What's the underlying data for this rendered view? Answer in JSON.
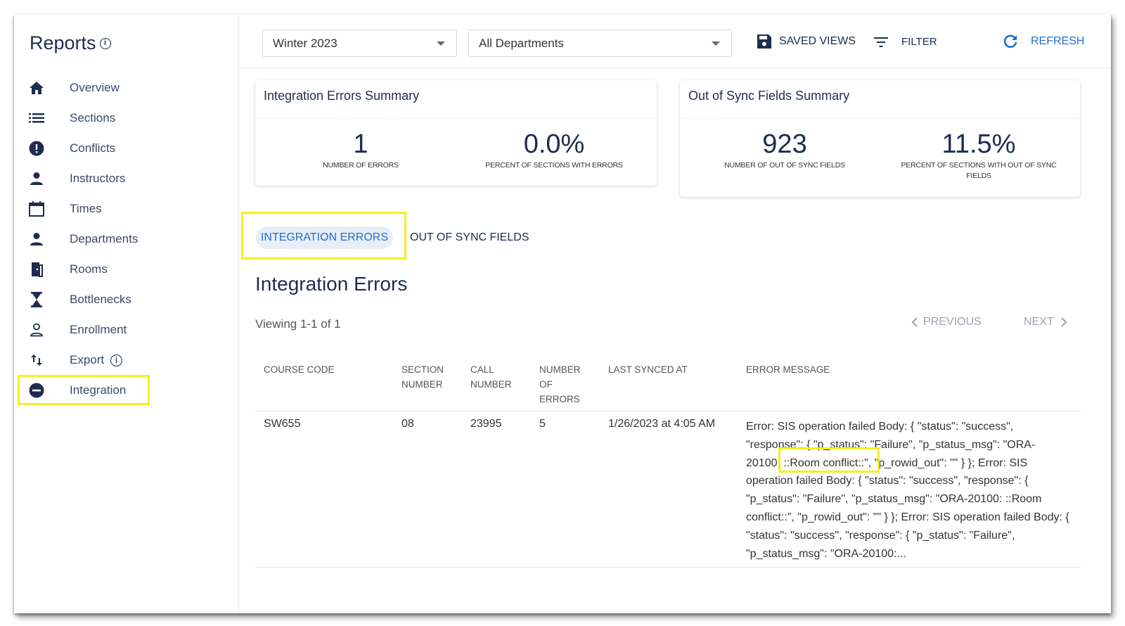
{
  "sidebar": {
    "title": "Reports",
    "items": [
      {
        "label": "Overview",
        "icon": "home-icon"
      },
      {
        "label": "Sections",
        "icon": "list-icon"
      },
      {
        "label": "Conflicts",
        "icon": "alert-circle-icon"
      },
      {
        "label": "Instructors",
        "icon": "person-icon"
      },
      {
        "label": "Times",
        "icon": "calendar-icon"
      },
      {
        "label": "Departments",
        "icon": "person-icon"
      },
      {
        "label": "Rooms",
        "icon": "door-icon"
      },
      {
        "label": "Bottlenecks",
        "icon": "hourglass-icon"
      },
      {
        "label": "Enrollment",
        "icon": "person-outline-icon"
      },
      {
        "label": "Export",
        "icon": "swap-vertical-icon"
      },
      {
        "label": "Integration",
        "icon": "minus-circle-icon",
        "active": true
      }
    ]
  },
  "toolbar": {
    "term": "Winter 2023",
    "department": "All Departments",
    "saved_views": "SAVED VIEWS",
    "filter": "FILTER",
    "refresh": "REFRESH"
  },
  "integration_summary": {
    "title": "Integration Errors Summary",
    "errors_value": "1",
    "errors_label": "NUMBER OF ERRORS",
    "percent_value": "0.0%",
    "percent_label": "PERCENT OF SECTIONS WITH ERRORS"
  },
  "sync_summary": {
    "title": "Out of Sync Fields Summary",
    "fields_value": "923",
    "fields_label": "NUMBER OF OUT OF SYNC FIELDS",
    "percent_value": "11.5%",
    "percent_label_line1": "PERCENT OF SECTIONS WITH OUT OF SYNC",
    "percent_label_line2": "FIELDS"
  },
  "tabs": {
    "active": "INTEGRATION ERRORS",
    "other": "OUT OF SYNC FIELDS"
  },
  "main": {
    "title": "Integration Errors",
    "viewing": "Viewing 1-1 of 1",
    "previous": "PREVIOUS",
    "next": "NEXT"
  },
  "table": {
    "headers": {
      "course_code": "COURSE CODE",
      "section_number_1": "SECTION",
      "section_number_2": "NUMBER",
      "call_number_1": "CALL",
      "call_number_2": "NUMBER",
      "num_errors_1": "NUMBER",
      "num_errors_2": "OF",
      "num_errors_3": "ERRORS",
      "last_synced": "LAST SYNCED AT",
      "error_message": "ERROR MESSAGE"
    },
    "rows": [
      {
        "course_code": "SW655",
        "section_number": "08",
        "call_number": "23995",
        "num_errors": "5",
        "last_synced": "1/26/2023 at 4:05 AM",
        "error_message": "Error: SIS operation failed Body: { \"status\": \"success\", \"response\": { \"p_status\": \"Failure\", \"p_status_msg\": \"ORA-20100: ::Room conflict::\", \"p_rowid_out\": \"\" } }; Error: SIS operation failed Body: { \"status\": \"success\", \"response\": { \"p_status\": \"Failure\", \"p_status_msg\": \"ORA-20100: ::Room conflict::\", \"p_rowid_out\": \"\" } }; Error: SIS operation failed Body: { \"status\": \"success\", \"response\": { \"p_status\": \"Failure\", \"p_status_msg\": \"ORA-20100:..."
      }
    ]
  },
  "colors": {
    "navy": "#1d2c4f",
    "accent_blue": "#1f6fd1",
    "highlight_yellow": "#f3f020"
  }
}
